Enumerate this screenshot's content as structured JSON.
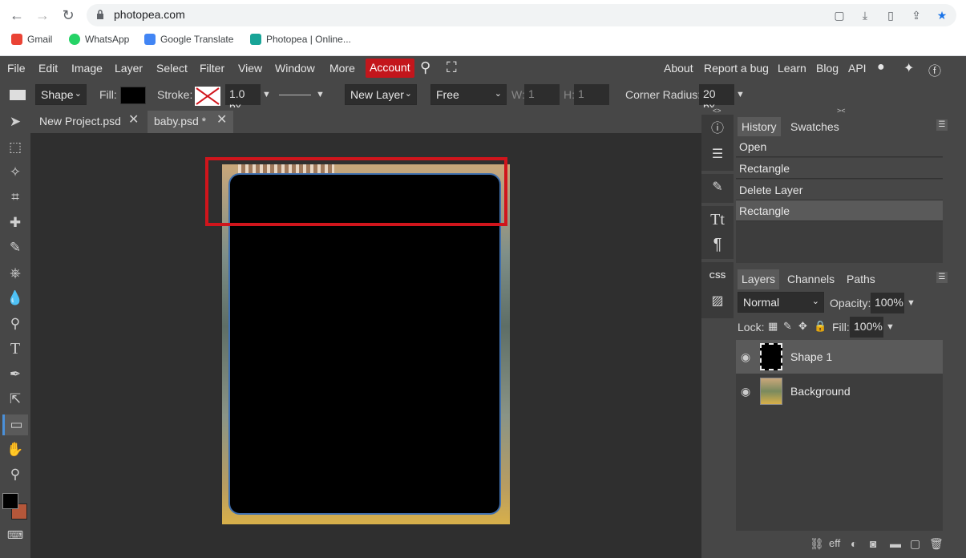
{
  "browser": {
    "url": "photopea.com",
    "bookmarks": [
      "Gmail",
      "WhatsApp",
      "Google Translate",
      "Photopea | Online..."
    ]
  },
  "menubar": {
    "items": [
      "File",
      "Edit",
      "Image",
      "Layer",
      "Select",
      "Filter",
      "View",
      "Window",
      "More"
    ],
    "account": "Account",
    "right_items": [
      "About",
      "Report a bug",
      "Learn",
      "Blog",
      "API"
    ]
  },
  "options": {
    "mode": "Shape",
    "fill_label": "Fill:",
    "stroke_label": "Stroke:",
    "stroke_width": "1.0 px",
    "layer_mode": "New Layer",
    "constraint": "Free",
    "w_label": "W:",
    "w_value": "1",
    "h_label": "H:",
    "h_value": "1",
    "corner_label": "Corner Radius:",
    "corner_value": "20 px"
  },
  "tabs": [
    {
      "label": "New Project.psd"
    },
    {
      "label": "baby.psd *"
    }
  ],
  "history": {
    "tabs": [
      "History",
      "Swatches"
    ],
    "rows": [
      "Open",
      "Rectangle",
      "Delete Layer",
      "Rectangle"
    ]
  },
  "layers": {
    "tabs": [
      "Layers",
      "Channels",
      "Paths"
    ],
    "blend": "Normal",
    "opacity_label": "Opacity:",
    "opacity_value": "100%",
    "lock_label": "Lock:",
    "fill_label": "Fill:",
    "fill_value": "100%",
    "rows": [
      {
        "name": "Shape 1"
      },
      {
        "name": "Background"
      }
    ]
  },
  "colors": {
    "accent": "#c3161c",
    "highlight": "#d0151c",
    "foreground": "#000000",
    "background": "#b5573a"
  }
}
